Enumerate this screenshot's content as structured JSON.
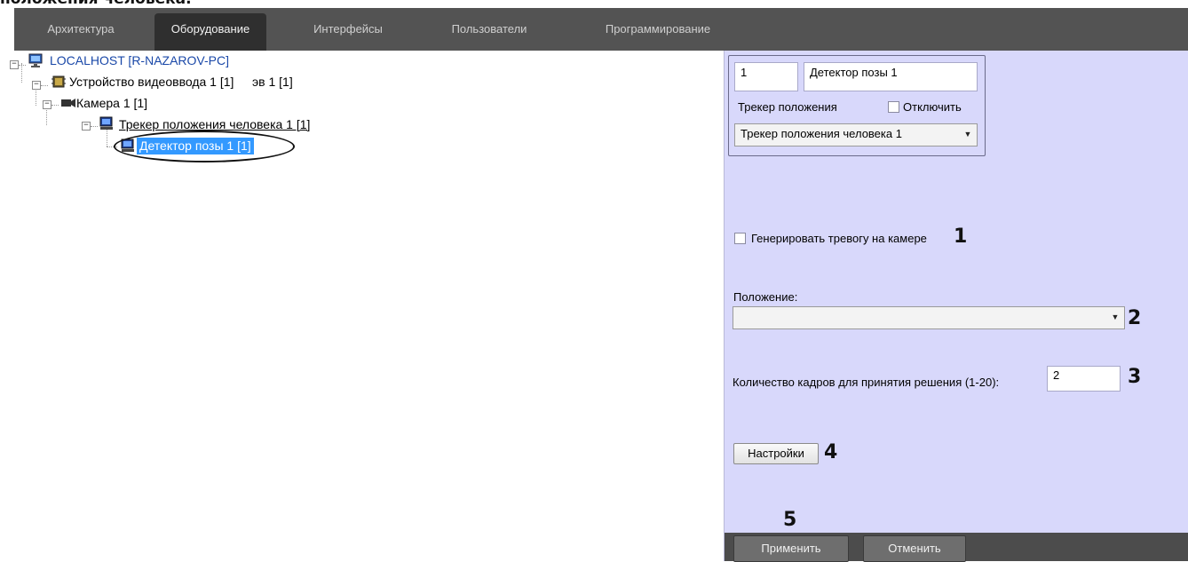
{
  "heading_fragment": "положения человека.",
  "tabs": [
    {
      "label": "Архитектура",
      "active": false
    },
    {
      "label": "Оборудование",
      "active": true
    },
    {
      "label": "Интерфейсы",
      "active": false
    },
    {
      "label": "Пользователи",
      "active": false
    },
    {
      "label": "Программирование",
      "active": false
    }
  ],
  "tree": {
    "root": "LOCALHOST [R-NAZAROV-PC]",
    "device": "Устройство видеоввода 1 [1]",
    "device_overlap": "эв 1 [1]",
    "camera": "Камера 1 [1]",
    "tracker": "Трекер положения человека 1 [1]",
    "detector": "Детектор позы 1 [1]"
  },
  "panel": {
    "id_value": "1",
    "name_value": "Детектор позы 1",
    "parent_label": "Трекер положения",
    "disable_label": "Отключить",
    "disable_checked": false,
    "parent_value": "Трекер положения человека 1",
    "alarm_label": "Генерировать тревогу на камере",
    "alarm_checked": false,
    "position_label": "Положение:",
    "position_value": "",
    "frames_label": "Количество кадров для принятия решения (1-20):",
    "frames_value": "2",
    "settings_button": "Настройки",
    "apply_button": "Применить",
    "cancel_button": "Отменить"
  },
  "markers": [
    "1",
    "2",
    "3",
    "4",
    "5"
  ],
  "colors": {
    "tab_bar": "#535353",
    "tab_active": "#2f2f2f",
    "panel_bg": "#d8d8fb",
    "selection": "#3399ff",
    "bottom_bar": "#4c4c4c"
  }
}
